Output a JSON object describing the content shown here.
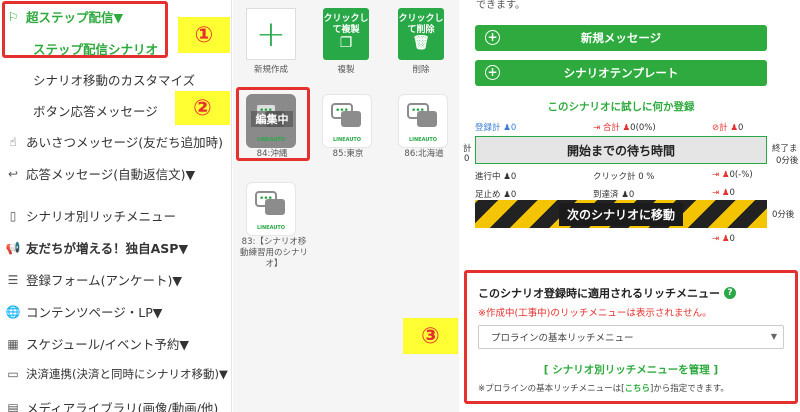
{
  "sidebar": {
    "header": "超ステップ配信▼",
    "step_scenario": "ステップ配信シナリオ",
    "sub_items": [
      "シナリオ移動のカスタマイズ",
      "ボタン応答メッセージ"
    ],
    "items": [
      {
        "label": "あいさつメッセージ(友だち追加時)",
        "icon": "hand-icon"
      },
      {
        "label": "応答メッセージ(自動返信文)▼",
        "icon": "reply-icon"
      },
      {
        "label": "シナリオ別リッチメニュー",
        "icon": "phone-icon"
      },
      {
        "label": "友だちが増える！独自ASP▼",
        "icon": "megaphone-icon"
      },
      {
        "label": "登録フォーム(アンケート)▼",
        "icon": "list-icon"
      },
      {
        "label": "コンテンツページ・LP▼",
        "icon": "globe-icon"
      },
      {
        "label": "スケジュール/イベント予約▼",
        "icon": "calendar-icon"
      },
      {
        "label": "決済連携(決済と同時にシナリオ移動)▼",
        "icon": "card-icon"
      },
      {
        "label": "メディアライブラリ(画像/動画/他)",
        "icon": "folder-icon"
      }
    ]
  },
  "callouts": {
    "one": "①",
    "two": "②",
    "three": "③"
  },
  "toolbar": {
    "new_label": "新規作成",
    "copy_btn": "クリックして複製",
    "copy_label": "複製",
    "delete_btn": "クリックして削除",
    "delete_label": "削除"
  },
  "scenarios": [
    {
      "label": "84:沖縄",
      "badge": "編集中",
      "brand": "LINEAUTO"
    },
    {
      "label": "85:東京",
      "brand": "LINEAUTO"
    },
    {
      "label": "86:北海道",
      "brand": "LINEAUTO"
    },
    {
      "label": "83:【シナリオ移動練習用のシナリオ】",
      "brand": "LINEAUTO"
    }
  ],
  "right": {
    "top_text": "できます。",
    "new_message": "新規メッセージ",
    "scenario_template": "シナリオテンプレート",
    "test_register": "このシナリオに試しに何か登録",
    "stats": {
      "registered": "登録計",
      "total": "合計",
      "total_val": "0(0%)",
      "block": "計",
      "progress": "進行中",
      "click_rate": "クリック計 0 %",
      "block_rate": "0(-%)",
      "stopped": "足止め",
      "reached": "到達済",
      "zero": "0"
    },
    "left_prefix": "計",
    "end_label": "終了ま",
    "zero_min": "0分後",
    "wait_time": "開始までの待ち時間",
    "next_scenario": "次のシナリオに移動"
  },
  "rich_menu": {
    "title": "このシナリオ登録時に適用されるリッチメニュー",
    "help": "?",
    "warning": "※作成中(工事中)のリッチメニューは表示されません。",
    "select_value": "プロラインの基本リッチメニュー",
    "manage_link": "[ シナリオ別リッチメニューを管理 ]",
    "note_prefix": "※プロラインの基本リッチメニューは[",
    "note_link": "こちら",
    "note_suffix": "]から指定できます。"
  },
  "colors": {
    "green": "#2eaa3f",
    "red": "#e53030",
    "yellow": "#ffff33"
  }
}
